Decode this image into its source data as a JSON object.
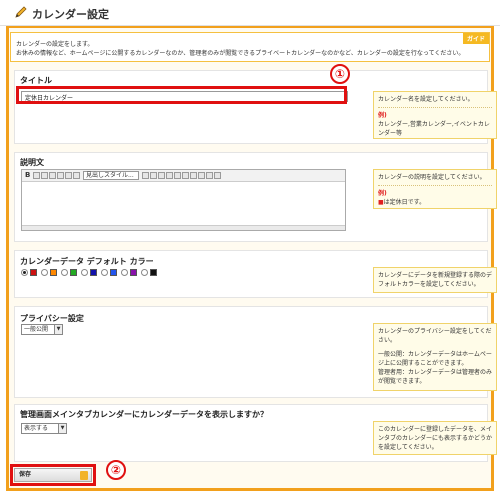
{
  "header": {
    "title": "カレンダー設定"
  },
  "guide": {
    "tag": "ガイド",
    "line1": "カレンダーの設定をします。",
    "line2": "お休みの情報など、ホームページに公開するカレンダーなのか、管理者のみが閲覧できるプライベートカレンダーなのかなど、カレンダーの設定を行なってください。"
  },
  "title_section": {
    "label": "タイトル",
    "value": "定休日カレンダー",
    "help": "カレンダー名を設定してください。",
    "example_tag": "例)",
    "example": "カレンダー,営業カレンダー,イベントカレンダー等"
  },
  "description_section": {
    "label": "説明文",
    "toolbar_style": "見出しスタイル...",
    "help": "カレンダーの説明を設定してください。",
    "example_tag": "例)",
    "example_mark": "■",
    "example": "は定休日です。"
  },
  "color_section": {
    "label": "カレンダーデータ デフォルト カラー",
    "colors": [
      "#cc1111",
      "#ff8800",
      "#22aa22",
      "#1111aa",
      "#2255ee",
      "#8811aa",
      "#111111"
    ],
    "selected": "#cc1111",
    "help": "カレンダーにデータを新規登録する際のデフォルトカラーを設定してください。"
  },
  "privacy_section": {
    "label": "プライバシー設定",
    "selected": "一般公開",
    "help1": "カレンダーのプライバシー設定をしてください。",
    "help2": "一般公開：カレンダーデータはホームページ上に公開することができます。",
    "help3": "管理者用：カレンダーデータは管理者のみが閲覧できます。"
  },
  "tab_section": {
    "label": "管理画面メインタブカレンダーにカレンダーデータを表示しますか？",
    "selected": "表示する",
    "help": "このカレンダーに登録したデータを、メインタブのカレンダーにも表示するかどうかを設定してください。"
  },
  "save": {
    "label": "保存"
  },
  "annotations": {
    "one": "①",
    "two": "②"
  }
}
